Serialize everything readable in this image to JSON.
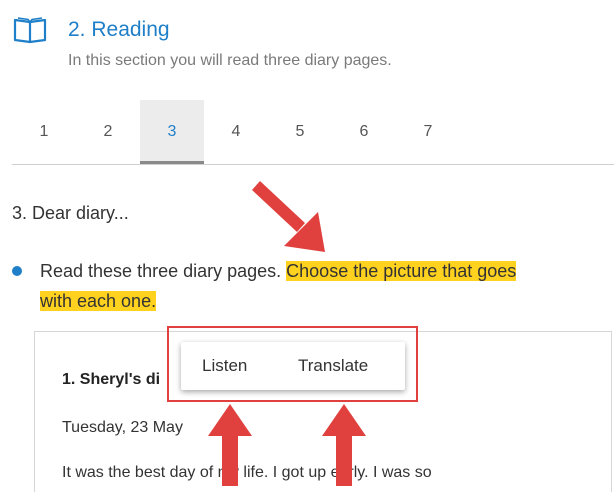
{
  "section": {
    "icon": "open-book-icon",
    "title": "2. Reading",
    "subtitle": "In this section you will read three diary pages."
  },
  "tabs": [
    {
      "label": "1",
      "active": false
    },
    {
      "label": "2",
      "active": false
    },
    {
      "label": "3",
      "active": true
    },
    {
      "label": "4",
      "active": false
    },
    {
      "label": "5",
      "active": false
    },
    {
      "label": "6",
      "active": false
    },
    {
      "label": "7",
      "active": false
    }
  ],
  "item": {
    "title": "3. Dear diary...",
    "instruction_plain": "Read these three diary pages. ",
    "instruction_highlight_1": "Choose the picture that goes",
    "instruction_highlight_2": "with each one."
  },
  "card": {
    "heading": "1. Sheryl's di",
    "date": "Tuesday, 23 May",
    "text": "It was the best day of my life. I got up early. I was so"
  },
  "popup": {
    "listen_label": "Listen",
    "translate_label": "Translate"
  },
  "colors": {
    "accent": "#1f7fc8",
    "highlight": "#ffd21f",
    "annotation": "#e0413e"
  }
}
